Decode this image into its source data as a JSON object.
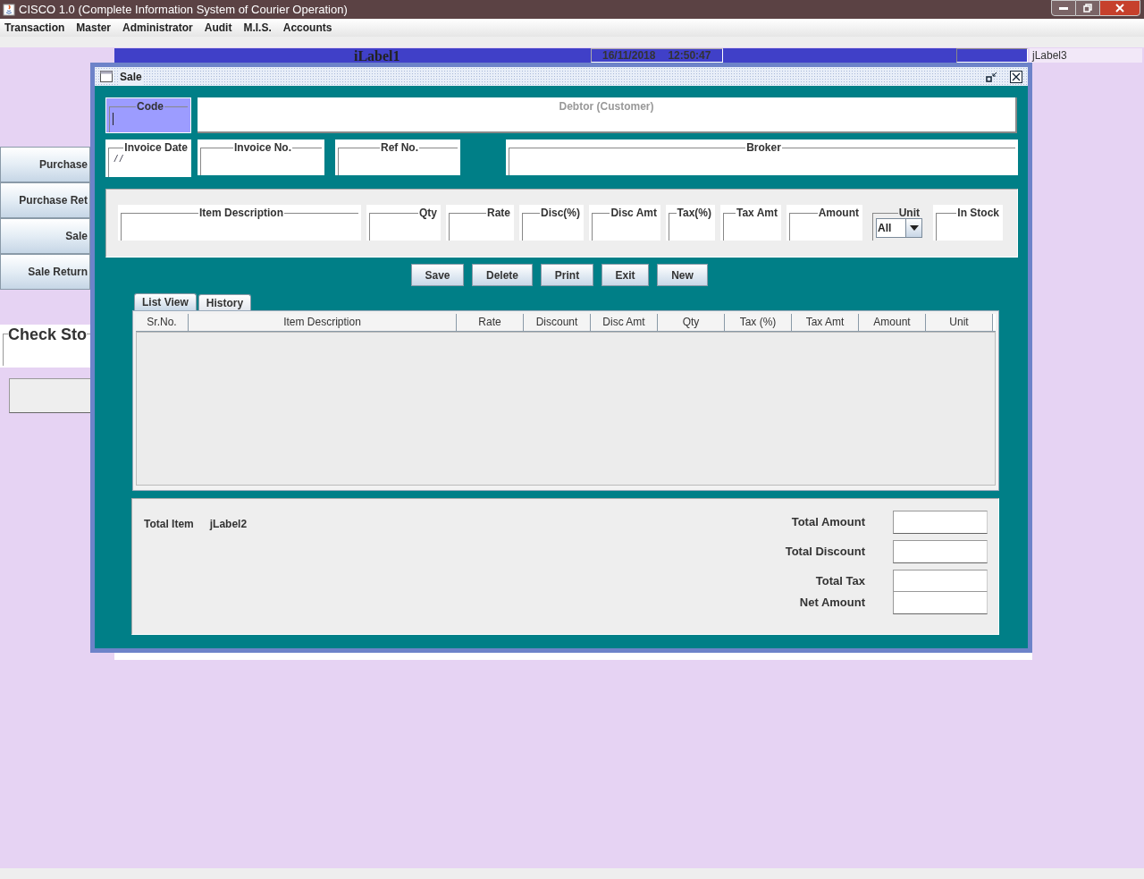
{
  "window": {
    "title": "CISCO 1.0 (Complete Information System of Courier Operation)"
  },
  "menu": [
    "Transaction",
    "Master",
    "Administrator",
    "Audit",
    "M.I.S.",
    "Accounts"
  ],
  "header_bar": {
    "label": "iLabel1",
    "date": "16/11/2018",
    "time": "12:50:47",
    "right_label": "jLabel3"
  },
  "side_buttons": [
    "Purchase",
    "Purchase Ret",
    "Sale",
    "Sale Return"
  ],
  "check_stock": {
    "title": "Check Sto"
  },
  "sale_window": {
    "title": "Sale",
    "code": {
      "label": "Code",
      "focused": true
    },
    "debtor": {
      "label": "Debtor (Customer)"
    },
    "header_fields": [
      {
        "label": "Invoice Date",
        "value": "/ /"
      },
      {
        "label": "Invoice No."
      },
      {
        "label": "Ref No."
      },
      {
        "label": "Broker"
      }
    ],
    "item_fields": [
      {
        "kind": "text",
        "label": "Item Description"
      },
      {
        "kind": "text",
        "label": "Qty"
      },
      {
        "kind": "text",
        "label": "Rate"
      },
      {
        "kind": "text",
        "label": "Disc(%)"
      },
      {
        "kind": "text",
        "label": "Disc Amt"
      },
      {
        "kind": "text",
        "label": "Tax(%)"
      },
      {
        "kind": "text",
        "label": "Tax Amt"
      },
      {
        "kind": "text",
        "label": "Amount"
      },
      {
        "kind": "dropdown",
        "label": "Unit",
        "value": "All"
      },
      {
        "kind": "text",
        "label": "In Stock"
      }
    ],
    "buttons": [
      "Save",
      "Delete",
      "Print",
      "Exit",
      "New"
    ],
    "tabs": [
      {
        "label": "List View",
        "selected": true
      },
      {
        "label": "History",
        "selected": false
      }
    ],
    "table": {
      "columns": [
        "Sr.No.",
        "Item Description",
        "Rate",
        "Discount",
        "Disc Amt",
        "Qty",
        "Tax (%)",
        "Tax Amt",
        "Amount",
        "Unit"
      ]
    },
    "totals": {
      "item_label": "Total Item",
      "item_value": "jLabel2",
      "rows": [
        "Total Amount",
        "Total Discount",
        "Total Tax",
        "Net Amount"
      ]
    }
  }
}
